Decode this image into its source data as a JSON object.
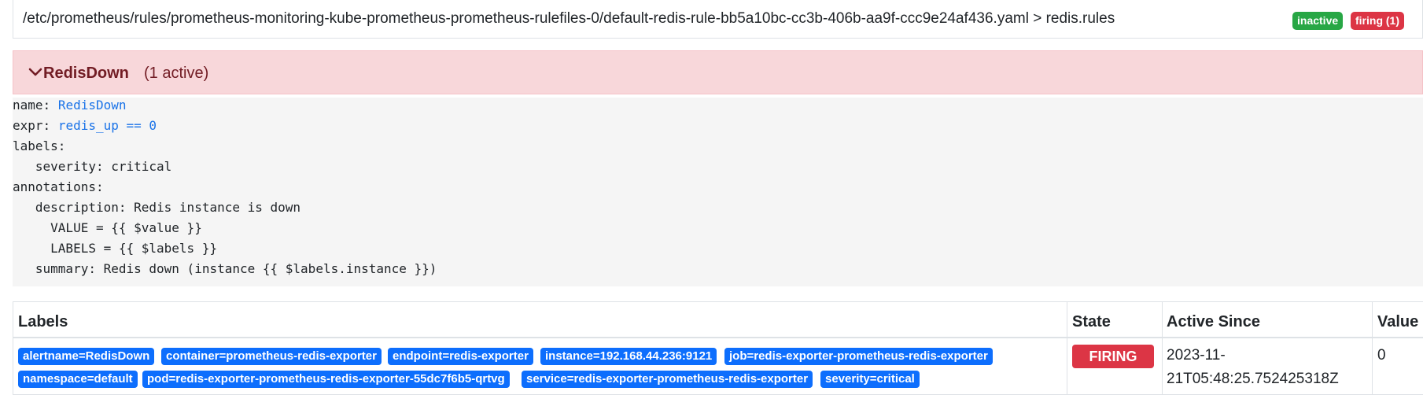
{
  "file_header": {
    "path": "/etc/prometheus/rules/prometheus-monitoring-kube-prometheus-prometheus-rulefiles-0/default-redis-rule-bb5a10bc-cc3b-406b-aa9f-ccc9e24af436.yaml > redis.rules",
    "badge_inactive": "inactive",
    "badge_firing": "firing (1)"
  },
  "alert": {
    "name": "RedisDown",
    "active_count": "(1 active)"
  },
  "rule": {
    "name_key": "name:",
    "name_value": "RedisDown",
    "expr_key": "expr:",
    "expr_value": "redis_up == 0",
    "labels_key": "labels:",
    "severity_line": "   severity: critical",
    "annotations_key": "annotations:",
    "description_line": "   description: Redis instance is down",
    "value_line": "     VALUE = {{ $value }}",
    "labels_line": "     LABELS = {{ $labels }}",
    "summary_line": "   summary: Redis down (instance {{ $labels.instance }})"
  },
  "table": {
    "headers": [
      "Labels",
      "State",
      "Active Since",
      "Value"
    ],
    "label_badges": [
      "alertname=RedisDown",
      "container=prometheus-redis-exporter",
      "endpoint=redis-exporter",
      "instance=192.168.44.236:9121",
      "job=redis-exporter-prometheus-redis-exporter",
      "namespace=default",
      "pod=redis-exporter-prometheus-redis-exporter-55dc7f6b5-qrtvg",
      "service=redis-exporter-prometheus-redis-exporter",
      "severity=critical"
    ],
    "state": "FIRING",
    "active_since": "2023-11-21T05:48:25.752425318Z",
    "value": "0"
  },
  "colors": {
    "firing": "#dc3545",
    "inactive": "#28a745",
    "label_badge": "#0d6efd",
    "alert_bg": "#f8d7da",
    "code_value": "#1a73e8"
  },
  "icons": {
    "collapse": "chevron-down-icon"
  }
}
